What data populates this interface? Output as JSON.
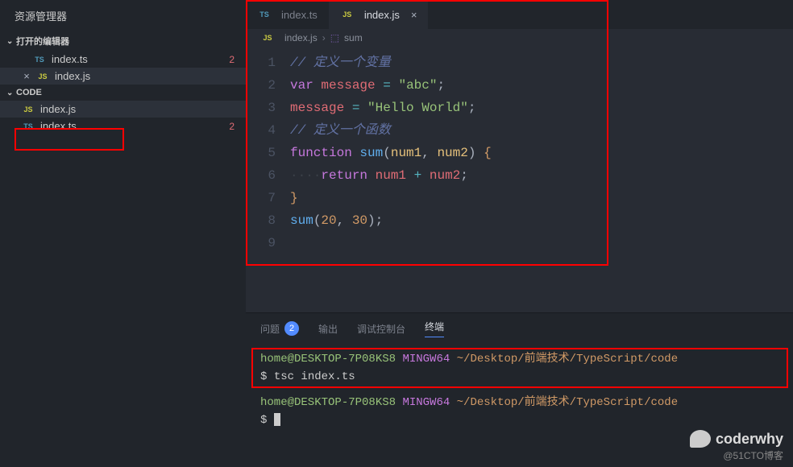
{
  "sidebar": {
    "title": "资源管理器",
    "openEditors": {
      "label": "打开的编辑器",
      "items": [
        {
          "icon": "TS",
          "name": "index.ts",
          "errors": "2"
        },
        {
          "icon": "JS",
          "name": "index.js",
          "closable": true
        }
      ]
    },
    "code": {
      "label": "CODE",
      "items": [
        {
          "icon": "JS",
          "name": "index.js"
        },
        {
          "icon": "TS",
          "name": "index.ts",
          "errors": "2"
        }
      ]
    }
  },
  "tabs": [
    {
      "icon": "TS",
      "name": "index.ts",
      "active": false
    },
    {
      "icon": "JS",
      "name": "index.js",
      "active": true
    }
  ],
  "breadcrumb": {
    "file": "index.js",
    "symbol": "sum"
  },
  "code": {
    "lines": [
      {
        "n": "1",
        "tokens": [
          {
            "t": "comment",
            "v": "// 定义一个变量"
          }
        ]
      },
      {
        "n": "2",
        "tokens": [
          {
            "t": "keyword",
            "v": "var"
          },
          {
            "t": "ws",
            "v": " "
          },
          {
            "t": "var",
            "v": "message"
          },
          {
            "t": "ws",
            "v": " "
          },
          {
            "t": "op",
            "v": "="
          },
          {
            "t": "ws",
            "v": " "
          },
          {
            "t": "string",
            "v": "\"abc\""
          },
          {
            "t": "punct",
            "v": ";"
          }
        ]
      },
      {
        "n": "3",
        "tokens": [
          {
            "t": "var",
            "v": "message"
          },
          {
            "t": "ws",
            "v": " "
          },
          {
            "t": "op",
            "v": "="
          },
          {
            "t": "ws",
            "v": " "
          },
          {
            "t": "string",
            "v": "\"Hello World\""
          },
          {
            "t": "punct",
            "v": ";"
          }
        ]
      },
      {
        "n": "4",
        "tokens": [
          {
            "t": "comment",
            "v": "// 定义一个函数"
          }
        ]
      },
      {
        "n": "5",
        "tokens": [
          {
            "t": "keyword",
            "v": "function"
          },
          {
            "t": "ws",
            "v": " "
          },
          {
            "t": "func",
            "v": "sum"
          },
          {
            "t": "punct",
            "v": "("
          },
          {
            "t": "param",
            "v": "num1"
          },
          {
            "t": "punct",
            "v": ", "
          },
          {
            "t": "param",
            "v": "num2"
          },
          {
            "t": "punct",
            "v": ") "
          },
          {
            "t": "brace",
            "v": "{"
          }
        ]
      },
      {
        "n": "6",
        "tokens": [
          {
            "t": "wsdot",
            "v": "····"
          },
          {
            "t": "keyword",
            "v": "return"
          },
          {
            "t": "ws",
            "v": " "
          },
          {
            "t": "var",
            "v": "num1"
          },
          {
            "t": "ws",
            "v": " "
          },
          {
            "t": "op",
            "v": "+"
          },
          {
            "t": "ws",
            "v": " "
          },
          {
            "t": "var",
            "v": "num2"
          },
          {
            "t": "punct",
            "v": ";"
          }
        ]
      },
      {
        "n": "7",
        "tokens": [
          {
            "t": "brace",
            "v": "}"
          }
        ]
      },
      {
        "n": "8",
        "tokens": [
          {
            "t": "func",
            "v": "sum"
          },
          {
            "t": "punct",
            "v": "("
          },
          {
            "t": "num",
            "v": "20"
          },
          {
            "t": "punct",
            "v": ", "
          },
          {
            "t": "num",
            "v": "30"
          },
          {
            "t": "punct",
            "v": ")"
          },
          {
            "t": "punct",
            "v": ";"
          }
        ]
      },
      {
        "n": "9",
        "tokens": []
      }
    ]
  },
  "panel": {
    "tabs": {
      "problems": "问题",
      "problemsCount": "2",
      "output": "输出",
      "debug": "调试控制台",
      "terminal": "终端"
    },
    "terminal": {
      "prompt1_user": "home@DESKTOP-7P08KS8",
      "prompt1_sys": "MINGW64",
      "prompt1_path": "~/Desktop/前端技术/TypeScript/code",
      "cmd1": "tsc index.ts",
      "prompt2_user": "home@DESKTOP-7P08KS8",
      "prompt2_sys": "MINGW64",
      "prompt2_path": "~/Desktop/前端技术/TypeScript/code",
      "dollar": "$"
    }
  },
  "watermark": {
    "text": "coderwhy",
    "sub": "@51CTO博客"
  }
}
